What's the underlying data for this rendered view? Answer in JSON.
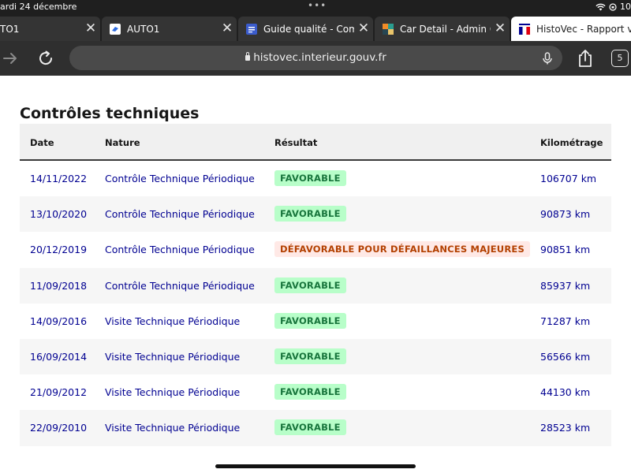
{
  "status_bar": {
    "time": "ardi 24 décembre",
    "dots": "•••",
    "battery": "10"
  },
  "tabs": [
    {
      "label": "TO1",
      "icon": "none",
      "active": false
    },
    {
      "label": "AUTO1",
      "icon": "auto1-logo-icon",
      "active": false
    },
    {
      "label": "Guide qualité - Comm",
      "icon": "document-icon",
      "active": false
    },
    {
      "label": "Car Detail - Admin Ce",
      "icon": "colored-squares-icon",
      "active": false
    },
    {
      "label": "HistoVec - Rapport ve",
      "icon": "histovec-logo-icon",
      "active": true
    }
  ],
  "toolbar": {
    "url": "histovec.interieur.gouv.fr",
    "tab_count": "5"
  },
  "page": {
    "title": "Contrôles techniques",
    "headers": {
      "date": "Date",
      "nature": "Nature",
      "result": "Résultat",
      "km": "Kilométrage"
    },
    "rows": [
      {
        "date": "14/11/2022",
        "nature": "Contrôle Technique Périodique",
        "result": "FAVORABLE",
        "status": "favorable",
        "km": "106707 km"
      },
      {
        "date": "13/10/2020",
        "nature": "Contrôle Technique Périodique",
        "result": "FAVORABLE",
        "status": "favorable",
        "km": "90873 km"
      },
      {
        "date": "20/12/2019",
        "nature": "Contrôle Technique Périodique",
        "result": "DÉFAVORABLE POUR DÉFAILLANCES MAJEURES",
        "status": "defavorable",
        "km": "90851 km"
      },
      {
        "date": "11/09/2018",
        "nature": "Contrôle Technique Périodique",
        "result": "FAVORABLE",
        "status": "favorable",
        "km": "85937 km"
      },
      {
        "date": "14/09/2016",
        "nature": "Visite Technique Périodique",
        "result": "FAVORABLE",
        "status": "favorable",
        "km": "71287 km"
      },
      {
        "date": "16/09/2014",
        "nature": "Visite Technique Périodique",
        "result": "FAVORABLE",
        "status": "favorable",
        "km": "56566 km"
      },
      {
        "date": "21/09/2012",
        "nature": "Visite Technique Périodique",
        "result": "FAVORABLE",
        "status": "favorable",
        "km": "44130 km"
      },
      {
        "date": "22/09/2010",
        "nature": "Visite Technique Périodique",
        "result": "FAVORABLE",
        "status": "favorable",
        "km": "28523 km"
      }
    ]
  },
  "colors": {
    "link_blue": "#000091",
    "favorable_bg": "#b8fec9",
    "favorable_text": "#18753c",
    "defavorable_bg": "#ffe9e6",
    "defavorable_text": "#b34000"
  }
}
